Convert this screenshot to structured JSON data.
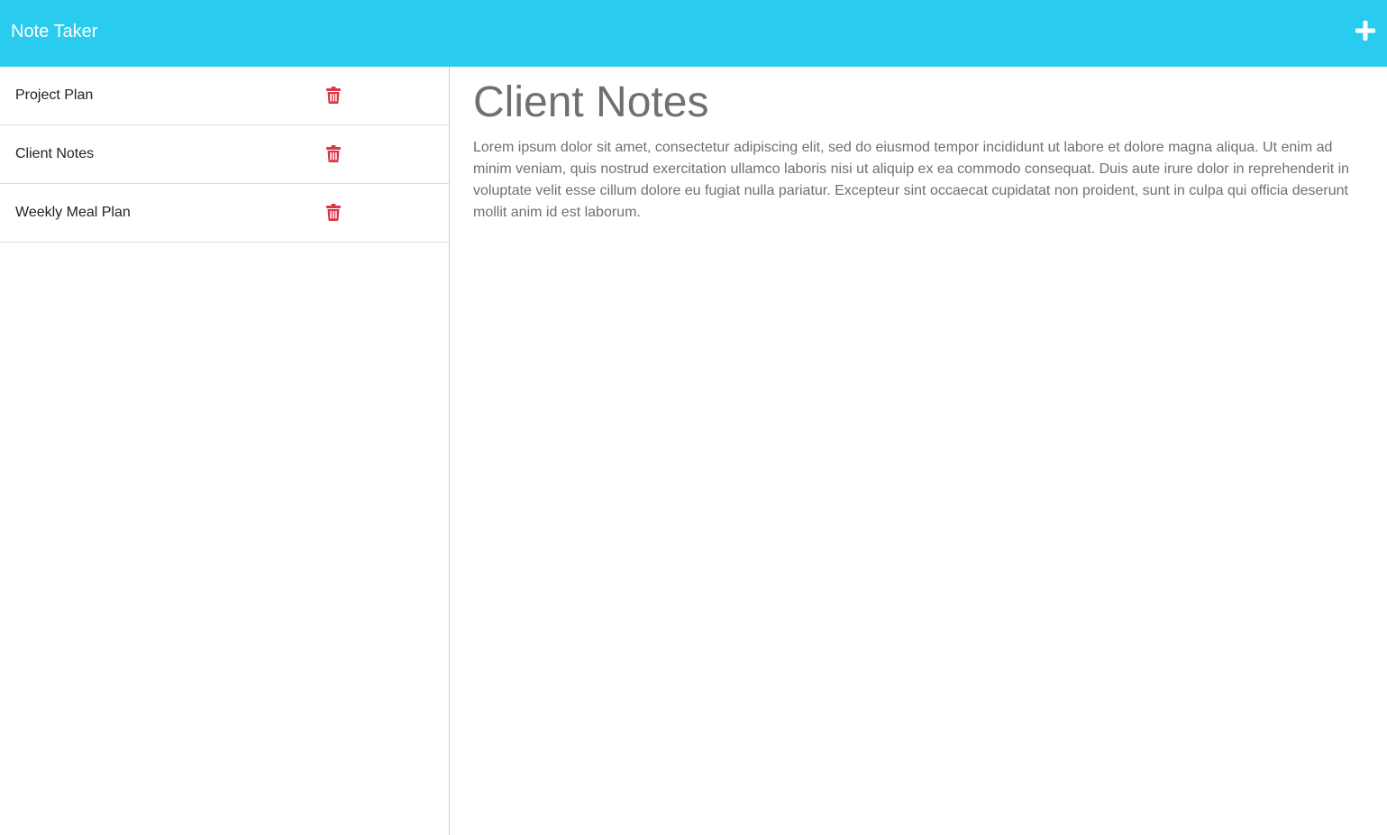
{
  "app": {
    "title": "Note Taker",
    "add_icon": "plus-icon",
    "accent_color": "#29cbee"
  },
  "sidebar": {
    "notes": [
      {
        "title": "Project Plan",
        "delete_icon": "trash-icon"
      },
      {
        "title": "Client Notes",
        "delete_icon": "trash-icon"
      },
      {
        "title": "Weekly Meal Plan",
        "delete_icon": "trash-icon"
      }
    ],
    "delete_color": "#dc3545"
  },
  "active_note": {
    "title": "Client Notes",
    "text": "Lorem ipsum dolor sit amet, consectetur adipiscing elit, sed do eiusmod tempor incididunt ut labore et dolore magna aliqua. Ut enim ad minim veniam, quis nostrud exercitation ullamco laboris nisi ut aliquip ex ea commodo consequat. Duis aute irure dolor in reprehenderit in voluptate velit esse cillum dolore eu fugiat nulla pariatur. Excepteur sint occaecat cupidatat non proident, sunt in culpa qui officia deserunt mollit anim id est laborum."
  }
}
